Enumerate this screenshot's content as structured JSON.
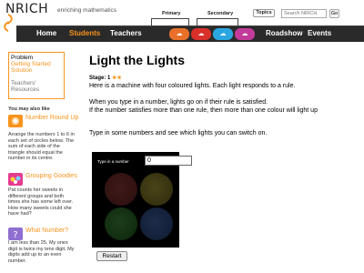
{
  "header": {
    "logo": "NRICH",
    "tagline": "enriching mathematics",
    "stage_primary": "Primary",
    "stage_secondary": "Secondary",
    "topics_label": "Topics",
    "search_placeholder": "Search NRICH",
    "go_label": "Go"
  },
  "nav": {
    "home": "Home",
    "students": "Students",
    "teachers": "Teachers",
    "roadshow": "Roadshow",
    "events": "Events",
    "stage_icons": [
      "stage-1-icon",
      "stage-2-icon",
      "stage-3-icon",
      "stage-4-icon"
    ]
  },
  "sidebar": {
    "problem": "Problem",
    "getting_started": "Getting Started",
    "solution": "Solution",
    "teachers": "Teachers'",
    "resources": "Resources",
    "may_like": "You may also like",
    "related": [
      {
        "title": "Number Round Up",
        "desc": "Arrange the numbers 1 to 6 in each set of circles below. The sum of each side of the triangle should equal the number in its centre."
      },
      {
        "title": "Grouping Goodies",
        "desc": "Pat counts her sweets in different groups and both times she has some left over. How many sweets could she have had?"
      },
      {
        "title": "What Number?",
        "desc": "I am less than 25. My ones digit is twice my tens digit. My digits add up to an even number."
      }
    ]
  },
  "main": {
    "title": "Light the Lights",
    "stage_label": "Stage: 1",
    "stars": "★★",
    "intro": "Here is a machine with four coloured lights. Each light responds to a rule.",
    "rule_line1": "When you type in a number, lights go on if their rule is satisfied.",
    "rule_line2": "If the number satisfies more than one rule, then more than one colour will light up",
    "instruction": "Type in some numbers and see which lights you can switch on."
  },
  "machine": {
    "input_label": "Type in a number",
    "input_value": "0",
    "lights": [
      "red",
      "yellow",
      "green",
      "blue"
    ],
    "restart_label": "Restart"
  },
  "colors": {
    "accent": "#f7941d",
    "navbar": "#2a2a2a"
  }
}
